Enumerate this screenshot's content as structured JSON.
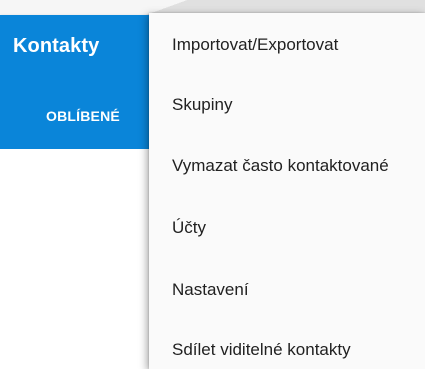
{
  "app": {
    "title": "Kontakty"
  },
  "tabs": {
    "favorites_label": "OBLÍBENÉ"
  },
  "overflow_menu": {
    "items": [
      {
        "label": "Importovat/Exportovat"
      },
      {
        "label": "Skupiny"
      },
      {
        "label": "Vymazat často kontaktované"
      },
      {
        "label": "Účty"
      },
      {
        "label": "Nastavení"
      },
      {
        "label": "Sdílet viditelné kontakty"
      }
    ]
  },
  "colors": {
    "app_bar": "#0a85d9",
    "menu_background": "#fafafa",
    "menu_text": "#212121"
  }
}
